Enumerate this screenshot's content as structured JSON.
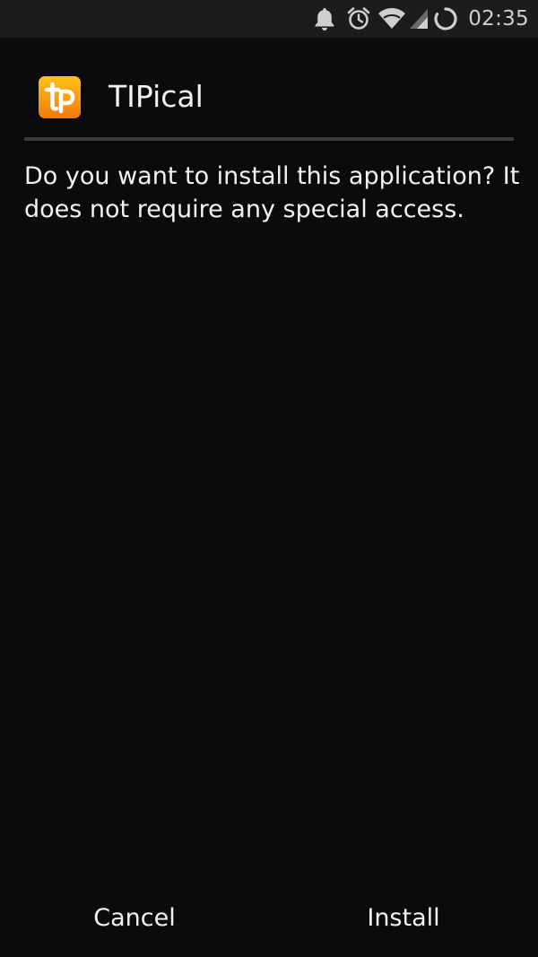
{
  "status_bar": {
    "icons": [
      "notification-bell-icon",
      "alarm-clock-icon",
      "wifi-icon",
      "signal-icon",
      "loading-spinner-icon"
    ],
    "time": "02:35"
  },
  "header": {
    "app_name": "TIPical",
    "app_icon": "tipical-app-icon",
    "icon_colors": [
      "#ffb300",
      "#f57c00"
    ]
  },
  "body": {
    "message": "Do you want to install this application? It does not require any special access."
  },
  "buttons": {
    "cancel_label": "Cancel",
    "install_label": "Install"
  }
}
